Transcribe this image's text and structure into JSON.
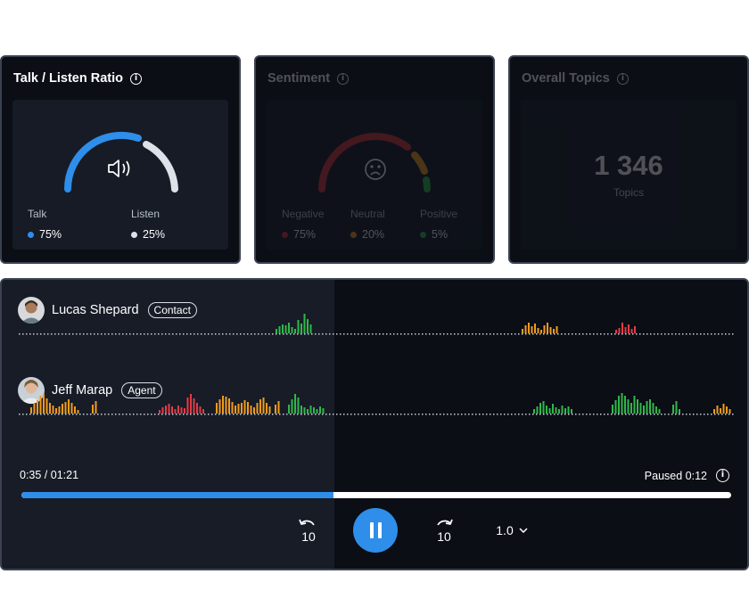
{
  "talk_listen": {
    "title": "Talk / Listen Ratio",
    "talk_label": "Talk",
    "talk_value": "75%",
    "listen_label": "Listen",
    "listen_value": "25%",
    "talk_fraction": 0.75,
    "colors": {
      "talk": "#2e8eea",
      "listen": "#dde1e8"
    },
    "icon": "speaker-icon"
  },
  "sentiment": {
    "title": "Sentiment",
    "negative_label": "Negative",
    "negative_value": "75%",
    "neutral_label": "Neutral",
    "neutral_value": "20%",
    "positive_label": "Positive",
    "positive_value": "5%",
    "colors": {
      "negative": "#d8323a",
      "neutral": "#f29b1d",
      "positive": "#2fb84a"
    },
    "icon": "sad-face-icon"
  },
  "topics": {
    "title": "Overall Topics",
    "count": "1 346",
    "label": "Topics"
  },
  "player": {
    "speakers": [
      {
        "name": "Lucas Shepard",
        "role": "Contact"
      },
      {
        "name": "Jeff Marap",
        "role": "Agent"
      }
    ],
    "current_time": "0:35 / 01:21",
    "paused_label": "Paused 0:12",
    "progress": 0.44,
    "rewind_label": "10",
    "forward_label": "10",
    "speed": "1.0"
  }
}
